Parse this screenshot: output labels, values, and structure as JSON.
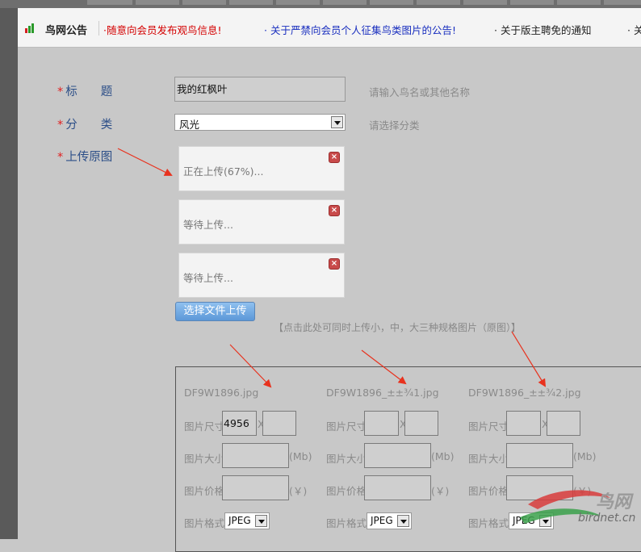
{
  "notice": {
    "title": "鸟网公告",
    "items": [
      {
        "text": "·随意向会员发布观鸟信息!",
        "color": "#d40000"
      },
      {
        "text": "· 关于严禁向会员个人征集鸟类图片的公告!",
        "color": "#1a2fbf"
      },
      {
        "text": "· 关于版主聘免的通知",
        "color": "#222222"
      },
      {
        "text": "· 关",
        "color": "#222222"
      }
    ]
  },
  "form": {
    "title_label": "标　　题",
    "title_value": "我的红枫叶",
    "title_hint": "请输入鸟名或其他名称",
    "category_label": "分　　类",
    "category_value": "风光",
    "category_hint": "请选择分类",
    "upload_label": "上传原图",
    "required_mark": "*"
  },
  "uploads": [
    {
      "status": "正在上传(67%)...",
      "progress": 67
    },
    {
      "status": "等待上传..."
    },
    {
      "status": "等待上传..."
    }
  ],
  "upload_button": "选择文件上传",
  "upload_tip": "【点击此处可同时上传小，中，大三种规格图片（原图）】",
  "files": [
    {
      "name": "DF9W1896.jpg",
      "width": "4956",
      "height": "",
      "size": "",
      "price": "",
      "format": "JPEG"
    },
    {
      "name": "DF9W1896_±±¾1.jpg",
      "width": "",
      "height": "",
      "size": "",
      "price": "",
      "format": "JPEG"
    },
    {
      "name": "DF9W1896_±±¾2.jpg",
      "width": "",
      "height": "",
      "size": "",
      "price": "",
      "format": "JPEG"
    }
  ],
  "field_labels": {
    "dim": "图片尺寸",
    "x": "X",
    "size": "图片大小",
    "size_unit": "(Mb)",
    "price": "图片价格",
    "price_unit": "(￥)",
    "format": "图片格式"
  },
  "watermark": {
    "brand": "鸟网",
    "site": "birdnet.cn"
  },
  "colors": {
    "required": "#e02020",
    "label": "#2d4f88",
    "arrow": "#e8321e"
  }
}
